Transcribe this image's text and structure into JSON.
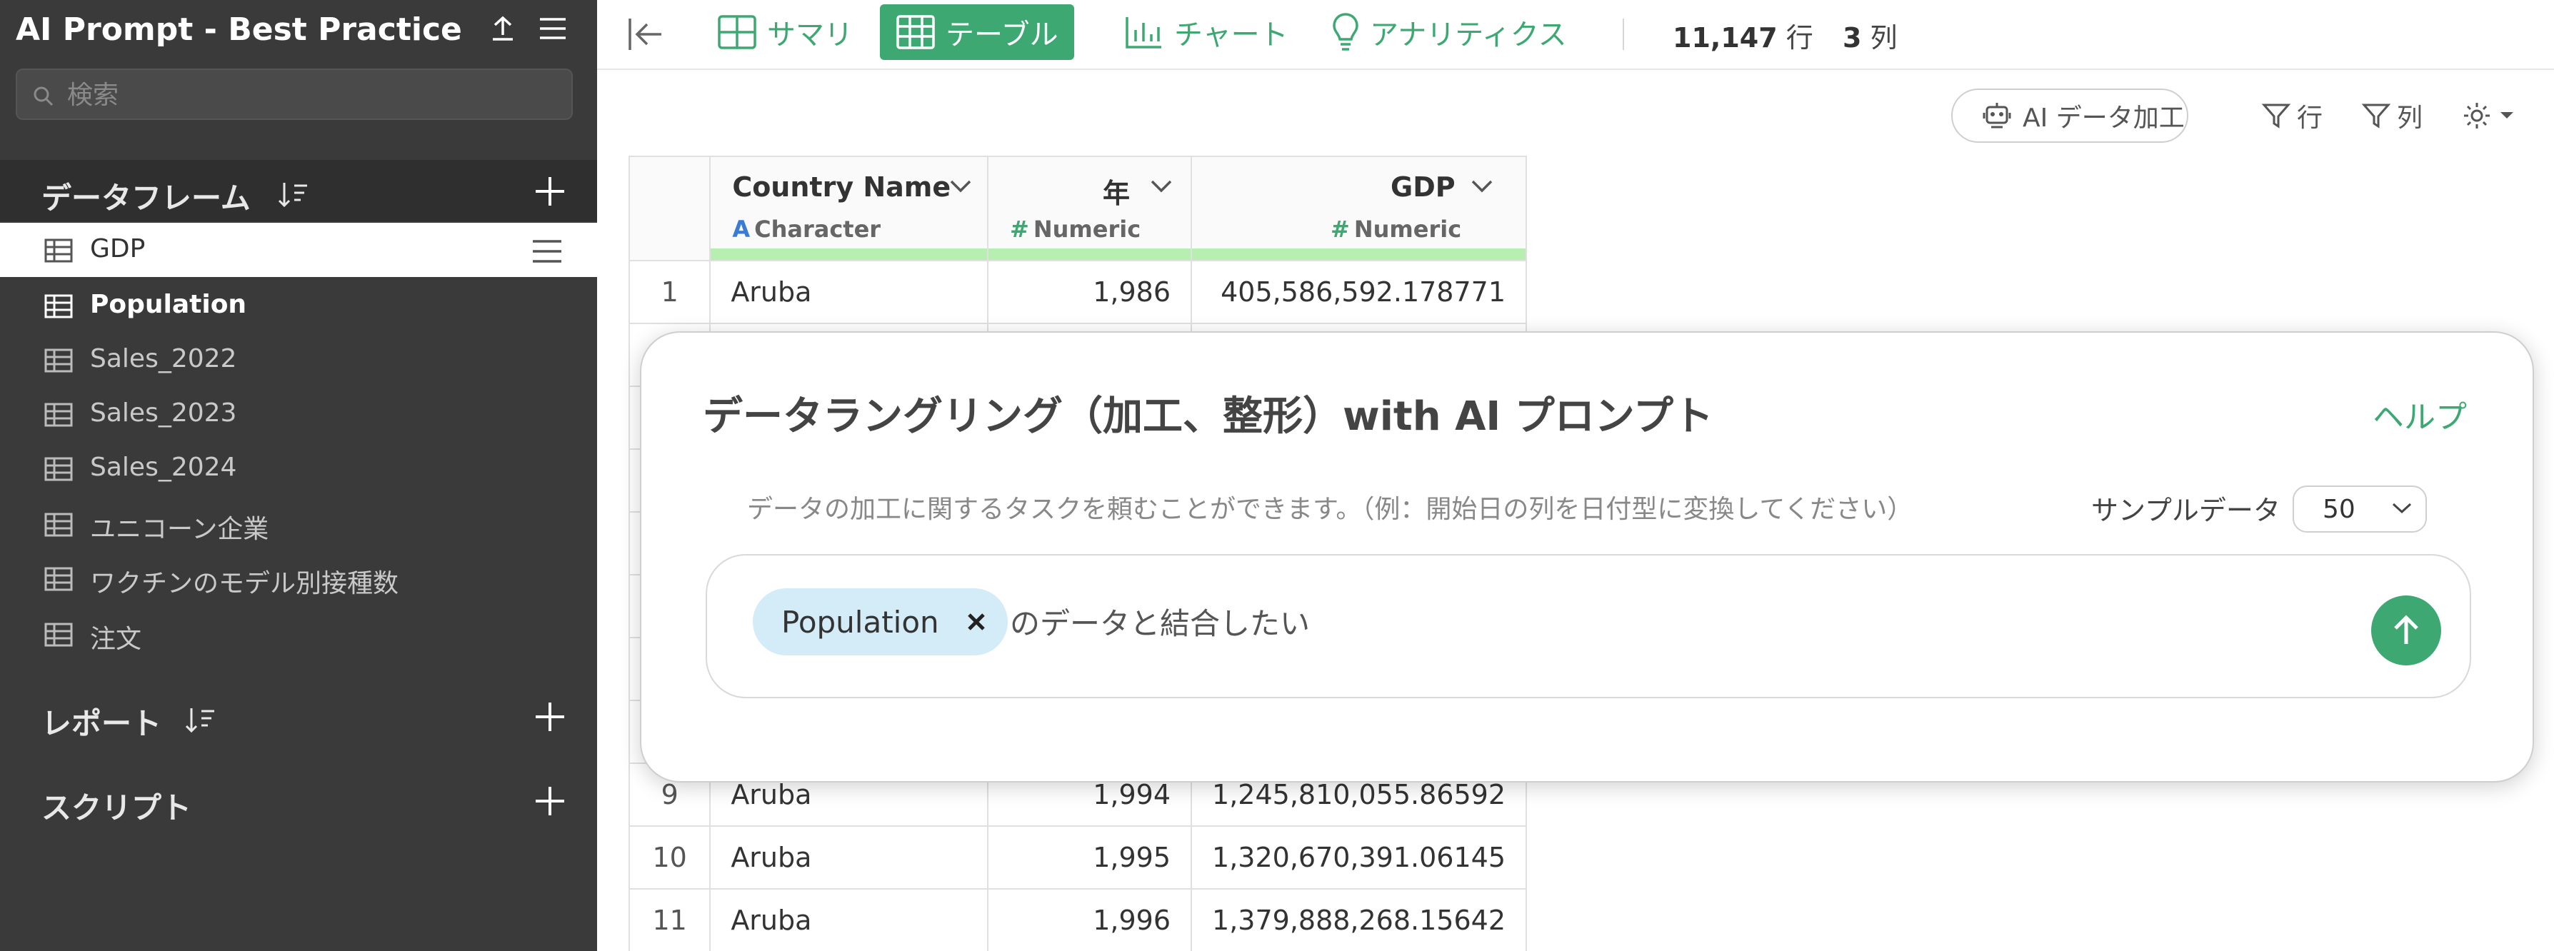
{
  "sidebar": {
    "title": "AI Prompt - Best Practice",
    "search_placeholder": "検索",
    "sections": {
      "dataframes": {
        "label": "データフレーム"
      },
      "reports": {
        "label": "レポート"
      },
      "scripts": {
        "label": "スクリプト"
      }
    },
    "dataframes": [
      {
        "label": "GDP"
      },
      {
        "label": "Population"
      },
      {
        "label": "Sales_2022"
      },
      {
        "label": "Sales_2023"
      },
      {
        "label": "Sales_2024"
      },
      {
        "label": "ユニコーン企業"
      },
      {
        "label": "ワクチンのモデル別接種数"
      },
      {
        "label": "注文"
      }
    ]
  },
  "toolbar": {
    "tabs": [
      {
        "label": "サマリ",
        "icon": "summary-icon"
      },
      {
        "label": "テーブル",
        "icon": "table-icon"
      },
      {
        "label": "チャート",
        "icon": "chart-icon"
      },
      {
        "label": "アナリティクス",
        "icon": "lightbulb-icon"
      }
    ],
    "rows_value": "11,147",
    "rows_unit": "行",
    "cols_value": "3",
    "cols_unit": "列"
  },
  "actions": {
    "ai_button": "AI データ加工",
    "row_filter": "行",
    "col_filter": "列"
  },
  "table": {
    "columns": [
      {
        "name": "Country Name",
        "type_icon": "A",
        "type": "Character"
      },
      {
        "name": "年",
        "type_icon": "#",
        "type": "Numeric"
      },
      {
        "name": "GDP",
        "type_icon": "#",
        "type": "Numeric"
      }
    ],
    "rows": [
      [
        "1",
        "Aruba",
        "1,986",
        "405,586,592.178771"
      ],
      [
        "9",
        "Aruba",
        "1,994",
        "1,245,810,055.86592"
      ],
      [
        "10",
        "Aruba",
        "1,995",
        "1,320,670,391.06145"
      ],
      [
        "11",
        "Aruba",
        "1,996",
        "1,379,888,268.15642"
      ]
    ]
  },
  "modal": {
    "title": "データラングリング（加工、整形）with AI プロンプト",
    "help": "ヘルプ",
    "description": "データの加工に関するタスクを頼むことができます。（例：開始日の列を日付型に変換してください）",
    "sample_label": "サンプルデータ",
    "sample_value": "50",
    "chip": "Population",
    "prompt_text": "のデータと結合したい"
  },
  "colors": {
    "accent": "#3ea873",
    "sidebar_bg": "#3a3a3a",
    "chip_bg": "#d4ebf8",
    "column_bar": "#b6efb0"
  }
}
